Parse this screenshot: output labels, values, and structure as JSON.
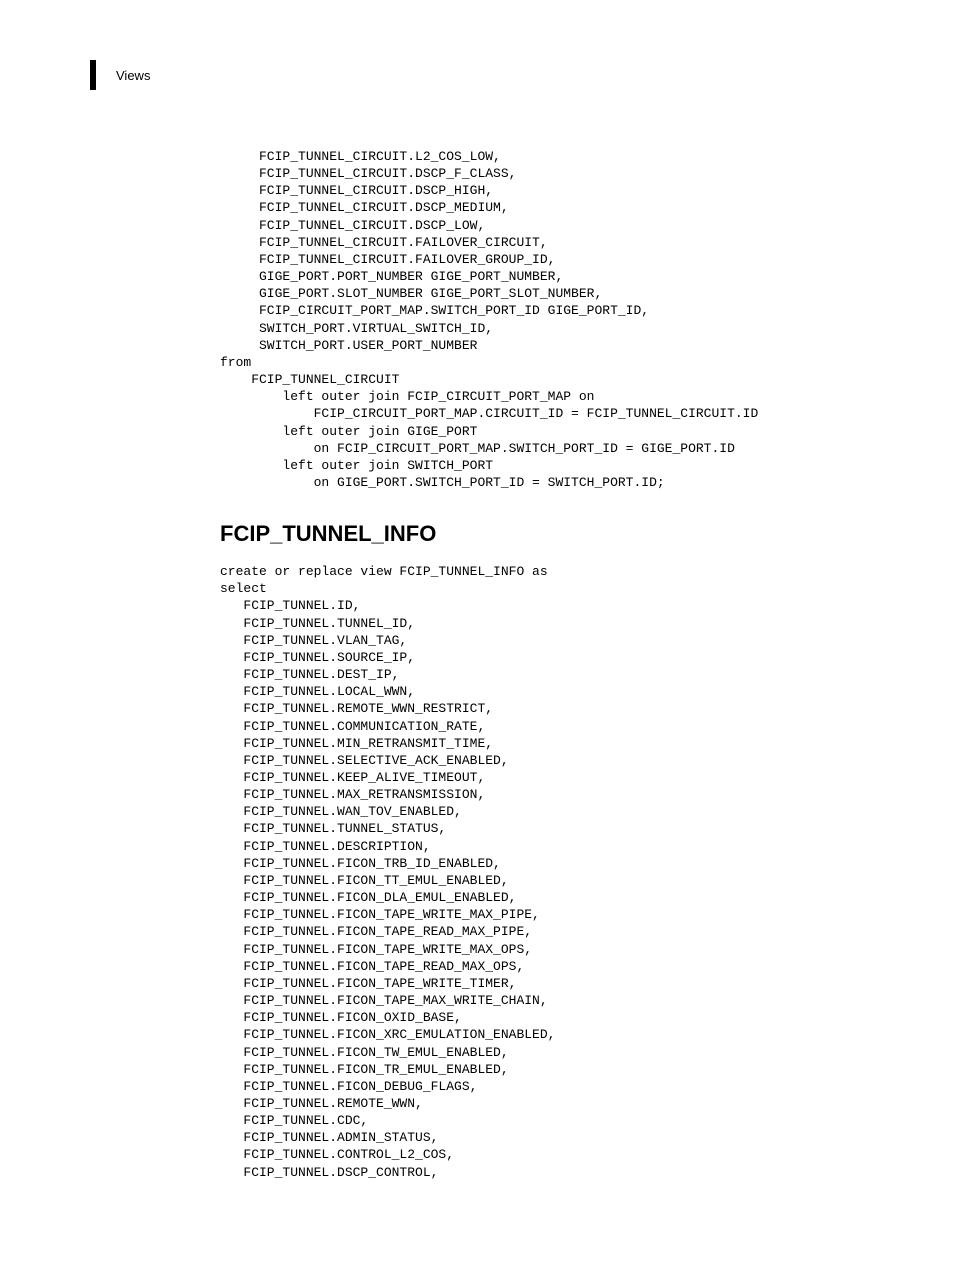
{
  "header": {
    "label": "Views"
  },
  "block1": "     FCIP_TUNNEL_CIRCUIT.L2_COS_LOW,\n     FCIP_TUNNEL_CIRCUIT.DSCP_F_CLASS,\n     FCIP_TUNNEL_CIRCUIT.DSCP_HIGH,\n     FCIP_TUNNEL_CIRCUIT.DSCP_MEDIUM,\n     FCIP_TUNNEL_CIRCUIT.DSCP_LOW,\n     FCIP_TUNNEL_CIRCUIT.FAILOVER_CIRCUIT,\n     FCIP_TUNNEL_CIRCUIT.FAILOVER_GROUP_ID,\n     GIGE_PORT.PORT_NUMBER GIGE_PORT_NUMBER,\n     GIGE_PORT.SLOT_NUMBER GIGE_PORT_SLOT_NUMBER,\n     FCIP_CIRCUIT_PORT_MAP.SWITCH_PORT_ID GIGE_PORT_ID,\n     SWITCH_PORT.VIRTUAL_SWITCH_ID,\n     SWITCH_PORT.USER_PORT_NUMBER\nfrom\n    FCIP_TUNNEL_CIRCUIT\n        left outer join FCIP_CIRCUIT_PORT_MAP on\n            FCIP_CIRCUIT_PORT_MAP.CIRCUIT_ID = FCIP_TUNNEL_CIRCUIT.ID\n        left outer join GIGE_PORT\n            on FCIP_CIRCUIT_PORT_MAP.SWITCH_PORT_ID = GIGE_PORT.ID\n        left outer join SWITCH_PORT\n            on GIGE_PORT.SWITCH_PORT_ID = SWITCH_PORT.ID;",
  "section": {
    "heading": "FCIP_TUNNEL_INFO"
  },
  "block2": "create or replace view FCIP_TUNNEL_INFO as\nselect\n   FCIP_TUNNEL.ID,\n   FCIP_TUNNEL.TUNNEL_ID,\n   FCIP_TUNNEL.VLAN_TAG,\n   FCIP_TUNNEL.SOURCE_IP,\n   FCIP_TUNNEL.DEST_IP,\n   FCIP_TUNNEL.LOCAL_WWN,\n   FCIP_TUNNEL.REMOTE_WWN_RESTRICT,\n   FCIP_TUNNEL.COMMUNICATION_RATE,\n   FCIP_TUNNEL.MIN_RETRANSMIT_TIME,\n   FCIP_TUNNEL.SELECTIVE_ACK_ENABLED,\n   FCIP_TUNNEL.KEEP_ALIVE_TIMEOUT,\n   FCIP_TUNNEL.MAX_RETRANSMISSION,\n   FCIP_TUNNEL.WAN_TOV_ENABLED,\n   FCIP_TUNNEL.TUNNEL_STATUS,\n   FCIP_TUNNEL.DESCRIPTION,\n   FCIP_TUNNEL.FICON_TRB_ID_ENABLED,\n   FCIP_TUNNEL.FICON_TT_EMUL_ENABLED,\n   FCIP_TUNNEL.FICON_DLA_EMUL_ENABLED,\n   FCIP_TUNNEL.FICON_TAPE_WRITE_MAX_PIPE,\n   FCIP_TUNNEL.FICON_TAPE_READ_MAX_PIPE,\n   FCIP_TUNNEL.FICON_TAPE_WRITE_MAX_OPS,\n   FCIP_TUNNEL.FICON_TAPE_READ_MAX_OPS,\n   FCIP_TUNNEL.FICON_TAPE_WRITE_TIMER,\n   FCIP_TUNNEL.FICON_TAPE_MAX_WRITE_CHAIN,\n   FCIP_TUNNEL.FICON_OXID_BASE,\n   FCIP_TUNNEL.FICON_XRC_EMULATION_ENABLED,\n   FCIP_TUNNEL.FICON_TW_EMUL_ENABLED,\n   FCIP_TUNNEL.FICON_TR_EMUL_ENABLED,\n   FCIP_TUNNEL.FICON_DEBUG_FLAGS,\n   FCIP_TUNNEL.REMOTE_WWN,\n   FCIP_TUNNEL.CDC,\n   FCIP_TUNNEL.ADMIN_STATUS,\n   FCIP_TUNNEL.CONTROL_L2_COS,\n   FCIP_TUNNEL.DSCP_CONTROL,"
}
